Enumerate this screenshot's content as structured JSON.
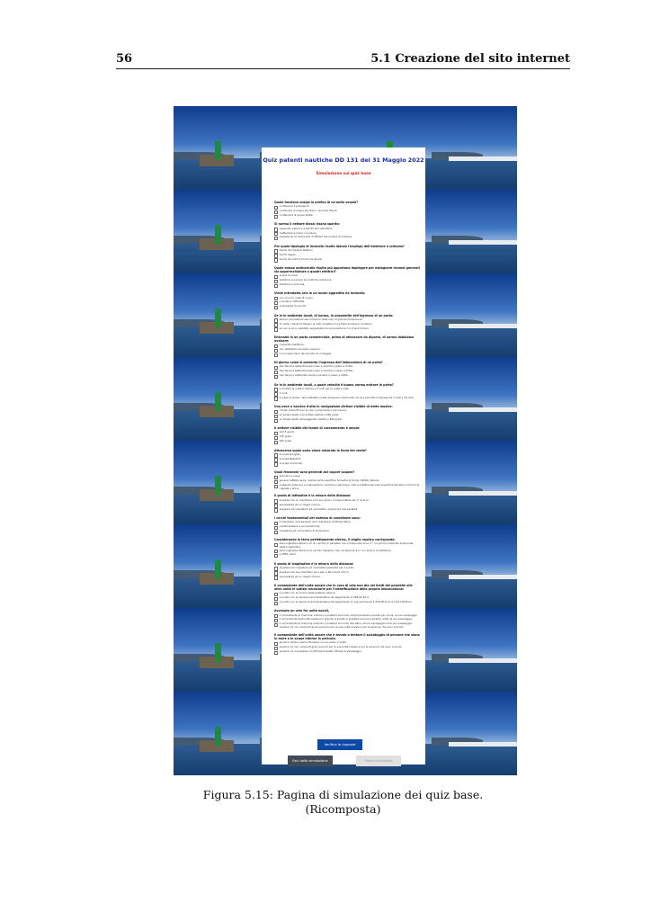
{
  "header": {
    "page_number": "56",
    "section": "5.1 Creazione del sito internet"
  },
  "screenshot": {
    "title": "Quiz patenti nautiche DD 131 del 31 Maggio 2022",
    "subtitle": "Simulazione sui quiz base",
    "questions": [
      {
        "q": "Quale funzione svolge la prefica di un'unità veuole?",
        "options": [
          "conferrerel il pulsuando",
          "conferrere di acque sportive o rinonola fiquidi",
          "conferrerla di acque sfette"
        ]
      },
      {
        "q": "Si norma il nettore dlosai risana sparito:",
        "options": [
          "usesando essurico e barufo tal cadnaltino.",
          "mettersolo a mano in suolino.",
          "impedendo al carburanti di affluire dal pompa di mezione."
        ]
      },
      {
        "q": "Per quale tipologia di incendio risulta idoneo l'impiego dell'estintore a schiuma?",
        "options": [
          "fuochi da impianti elettrici.",
          "fuochi degas.",
          "fuochi da solidi e fuochi da liquidi."
        ]
      },
      {
        "q": "Quale messo antincendio risulta più opportuno impiegare per estinguere incendi generati sia apparecchiature a quadri elettrici?",
        "options": [
          "acqua di sosia.",
          "estintore a polvere ad anidride carbonica.",
          "estintore a schiuma."
        ]
      },
      {
        "q": "Viene introdotta aria in un locale aggredito da incendio:",
        "options": [
          "non occorre nulla di nuovo.",
          "il locale si raffredda.",
          "si alimenta l'incendio."
        ]
      },
      {
        "q": "Se in in ambiente locali, di norma, in prossimità dell'ingresso di un porto:",
        "options": [
          "stanno procedendo alle manovre delle navi di grande dimensione.",
          "di notte, i fanali fo fissano ai rosti arrestano luce fissa verde per riccitarsi.",
          "se non si sono visibilità, segnalatore la sua posizione con 2 suoni brevi."
        ]
      },
      {
        "q": "Entrando in un porto commerciale, prima di attraccare da diporto, di norma dobbiamo avvisare:",
        "options": [
          "l'autorità marittima.",
          "non dobbiamo avvisare nessuno.",
          "il concessionario del servizio di ormeggio."
        ]
      },
      {
        "q": "Di giorno come si presenta l'ingresso dell'imboccatura di un porto?",
        "options": [
          "due fanali a settentrionale rosso a sinistra e giallo a dritta.",
          "due fanali a settentrionale rosso a sinistra e verde a dritta.",
          "due fanali e sotterrato verde a sinistra e rosso a dritta."
        ]
      },
      {
        "q": "Se in in ambiente locali, a quale velocità è buona norma entrare in porto?",
        "options": [
          "A mollare la unità a motore e 3 nodi per le unità a vela.",
          "3 nodi.",
          "in base al tempo, alla visibilità ed alle dimensioni dell'unità, ad una velocità compresa tra 3 nodi e 10 nodi."
        ]
      },
      {
        "q": "Una nave a vaccino d'alto in navigazione diviene visibile di notte mostra:",
        "options": [
          "i fanali prescritti per le navi a propulsione meccanica.",
          "un fanale giallo a luce fissa visibile a 360 gradi.",
          "un fanale giallo lampeggiante visibile a 360 gradi."
        ]
      },
      {
        "q": "Il settore visibile del fanale di coronamento è ampio:",
        "options": [
          "112,5 gradi.",
          "135 gradi.",
          "225 gradi."
        ]
      },
      {
        "q": "Attraverso quale scala viene misurata la forza del vento?",
        "options": [
          "la scala Douglas.",
          "la scala Beaufort.",
          "la scala di Coriolis."
        ]
      },
      {
        "q": "Quali fenomeni sono generati dal vapore acqueo?",
        "options": [
          "grandine e neve.",
          "genera l'effetto serra, mentre sulla superficie terrestre si forma l'effetto albedo.",
          "a seguito della sua condensazione, nell'aria si generano nubi e sottilmente sulla superficie terrestre si forma la rugiada e brina."
        ]
      },
      {
        "q": "Il grado di latitudine è la misura della distanza:",
        "options": [
          "angolare tra un meridiano ed il suo primo corrispondente ad 1° di arco.",
          "equivalente ad un miglio marino.",
          "angolare tra l'equatore ed il parallelo, oppure tra due paralleli."
        ]
      },
      {
        "q": "I cerchi fondamentali del sistema di coordinate sono:",
        "options": [
          "il meridiano di Greenwich ed il meridiano di Monte Mario.",
          "l'antimeridiano e la lossodromia.",
          "l'equatore ed il meridiano di Greenwich."
        ]
      },
      {
        "q": "Considerando la terra perfettamente sferica, il miglio nautico corrisponde:",
        "options": [
          "alla lunghezza dell'arco di un cerchio di parallelo che corrisponde ad un 1° (un primo) misurato sulla scala della longitudine.",
          "alla lunghezza dell'arco di cerchio massimo che corrisponde a 1° (un primo) di latitudine.",
          "a 1852 metri."
        ]
      },
      {
        "q": "Il grado di longitudine è la misura della distanza:",
        "options": [
          "angolare tra l'equatore ed il parallelo passante per il punto.",
          "angolare tra due meridiani ed è pari a 60 minuti d'arco.",
          "equivalente ad un miglio marino."
        ]
      },
      {
        "q": "Il comandante dell'unità navale che in caso di urto non dia nei limiti del possibile alle altre unità le notizie necessarie per l'identificazione della propria imbarcazione:",
        "options": [
          "è punito con la revoca della patente nautica.",
          "è punito con la sanzione amministrativa del pagamento di 266,00 Euro.",
          "è punito con la sanzione amministrativa del pagamento di una somma da 1.476,00 Euro a 4.817,00 Euro."
        ]
      },
      {
        "q": "Avvenuto un urto fra unità navali,",
        "options": [
          "il comandante di ciascuna, a fermo e prestare soccorso reciprocamente e quella più vicina, al suo equipaggio.",
          "il comandante dell'unità navale più grande, è tenuto a prestare soccorso all'altra unità, al suo equipaggio.",
          "il comandante di ciascuna è tenuto a prestare soccorso alle altre, al loro equipaggio ed ai loro passeggeri, qualora ciò non comporti grave pericolo per la sua unità navale e per le persone che sono a bordo."
        ]
      },
      {
        "q": "Il comandante dell'unità navale che è tenuto a tentare il salvataggio di persone che siano in mare o in acque interne in pericolo:",
        "options": [
          "qualora l'allievo dell'unità libera non eccede i 2 metri.",
          "qualora ciò non comporti gravi pericoli per la sua unità navale e per le persone che sono a bordo.",
          "qualora ciò in possesso di ufficiale brevetti ufficiali di salvataggio."
        ]
      }
    ],
    "verify_button": "Verifica le risposte",
    "exit_button": "Esci dalla simulazione",
    "next_button": "Prova successiva"
  },
  "caption": {
    "line1": "Figura 5.15: Pagina di simulazione dei quiz base.",
    "line2": "(Ricomposta)"
  }
}
